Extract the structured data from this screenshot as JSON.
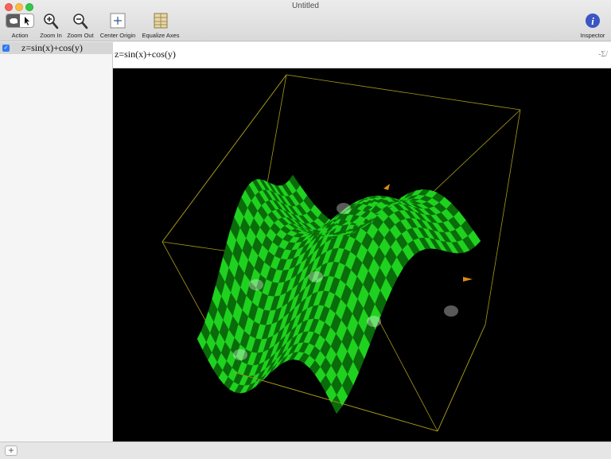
{
  "window": {
    "title": "Untitled"
  },
  "toolbar": {
    "action_label": "Action",
    "zoom_in_label": "Zoom In",
    "zoom_out_label": "Zoom Out",
    "center_origin_label": "Center Origin",
    "equalize_axes_label": "Equalize Axes",
    "inspector_label": "Inspector"
  },
  "sidebar": {
    "equations": [
      {
        "text": "z=sin(x)+cos(y)",
        "checked": true
      }
    ]
  },
  "formula": {
    "text": "z=sin(x)+cos(y)",
    "sigma_label": "-Σ/"
  },
  "graph": {
    "equation": "z=sin(x)+cos(y)",
    "surface_colors": [
      "#1fd21f",
      "#0a6b0a"
    ],
    "box_color": "#a89a1a",
    "background": "#000000"
  },
  "colors": {
    "accent": "#2e7cf6",
    "inspector": "#3a56c4"
  },
  "bottom": {
    "add_label": "+"
  }
}
